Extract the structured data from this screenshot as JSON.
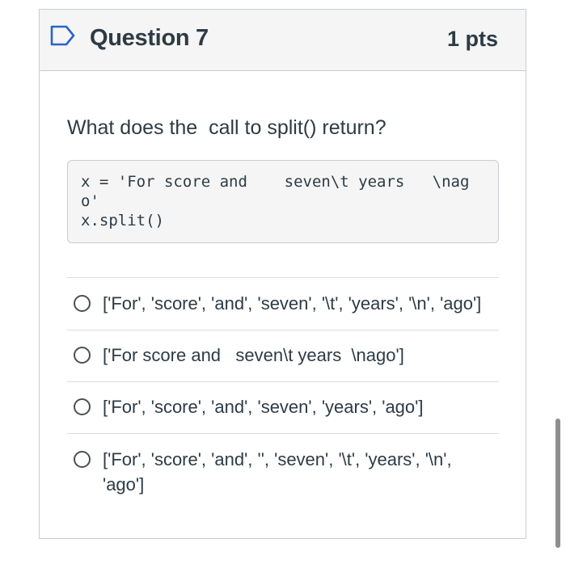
{
  "question": {
    "title": "Question 7",
    "points": "1 pts",
    "prompt": "What does the  call to split() return?",
    "code_lines": [
      "x = 'For score and    seven\\t years   \\nag",
      "o'",
      "x.split()"
    ],
    "answers": [
      {
        "label": "['For', 'score', 'and', 'seven', '\\t', 'years', '\\n', 'ago']"
      },
      {
        "label": "['For score and   seven\\t years  \\nago']"
      },
      {
        "label": "['For', 'score', 'and', 'seven', 'years', 'ago']"
      },
      {
        "label": "['For', 'score', 'and', '', 'seven', '\\t', 'years', '\\n',\n'ago']"
      }
    ]
  },
  "icons": {
    "flag": "bookmark-flag-icon",
    "radio": "radio-unselected-icon"
  },
  "colors": {
    "header_bg": "#f5f5f5",
    "text": "#2d3b45",
    "border": "#c7cdd1"
  }
}
